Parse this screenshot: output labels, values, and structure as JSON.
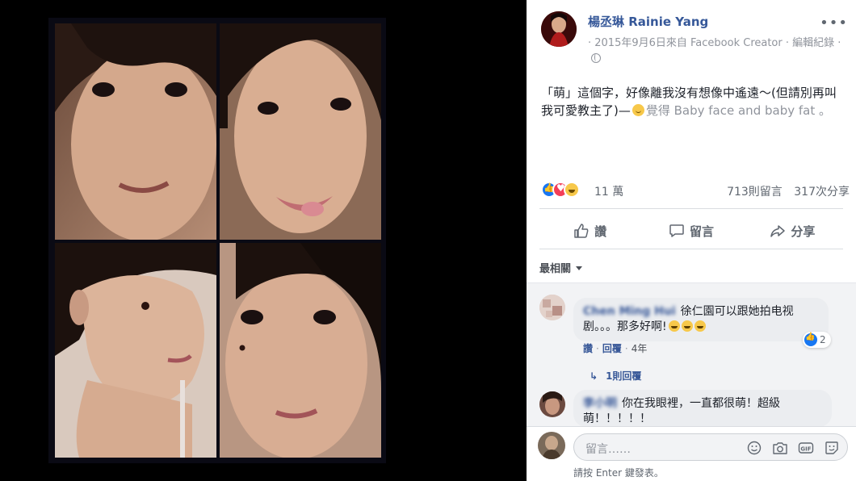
{
  "post": {
    "page_name": "楊丞琳 Rainie Yang",
    "meta": "· 2015年9月6日來自 Facebook Creator · 編輯紀錄 ·",
    "avatar_icon": "profile-avatar",
    "body": "「萌」這個字，好像離我沒有想像中遙遠～(但請別再叫我可愛教主了)—",
    "body_tail": "覺得 Baby face and baby fat 。"
  },
  "reactions": {
    "count": "11 萬",
    "comments": "713則留言",
    "shares": "317次分享"
  },
  "actions": {
    "like": "讚",
    "comment": "留言",
    "share": "分享"
  },
  "sort": {
    "label": "最相關"
  },
  "comments": [
    {
      "name": "Chen Ming Hui",
      "text": "徐仁園可以跟她拍电视剧。。。那多好啊!",
      "likes": "2",
      "like": "讚",
      "reply": "回覆",
      "age": "4年",
      "replies": "1則回覆"
    },
    {
      "name": "李小明",
      "text": "你在我眼裡，一直都很萌！超級萌！！！！！"
    }
  ],
  "composer": {
    "placeholder": "留言……",
    "hint": "請按 Enter 鍵發表。"
  },
  "colors": {
    "link": "#365899",
    "muted": "#90949c",
    "like_blue": "#1877f2"
  }
}
